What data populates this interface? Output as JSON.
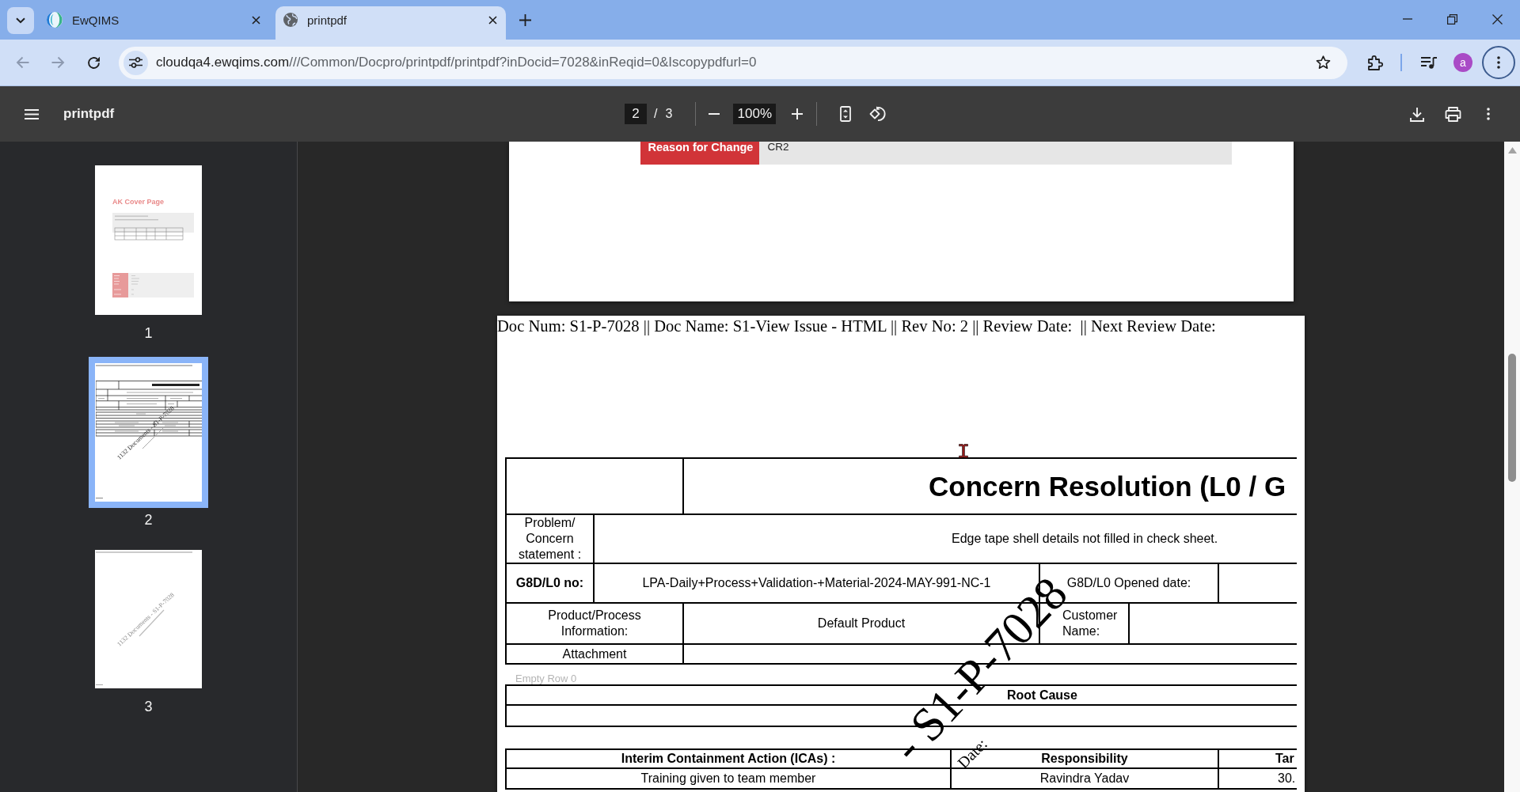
{
  "browser": {
    "tabs": [
      {
        "kind": "app",
        "title": "EwQIMS",
        "selected": false
      },
      {
        "kind": "web",
        "title": "printpdf",
        "selected": true
      }
    ],
    "navigation": [
      {
        "kind": "back",
        "disabled": true
      },
      {
        "kind": "forward",
        "disabled": true
      },
      {
        "kind": "reload",
        "disabled": false
      }
    ],
    "address": {
      "host": "cloudqa4.ewqims.com",
      "path": "///Common/Docpro/printpdf/printpdf?inDocid=7028&inReqid=0&Iscopypdfurl=0"
    },
    "profile_initial": "a"
  },
  "viewer": {
    "title": "printpdf",
    "page": "2",
    "separator": "/",
    "page_count": "3",
    "zoom": "100%"
  },
  "thumbnails": [
    {
      "kind": "cover",
      "heading": "AK Cover Page",
      "label": "1",
      "selected": false
    },
    {
      "kind": "form",
      "watermark": "1132 Documents - S1-P-7028",
      "label": "2",
      "selected": true
    },
    {
      "kind": "blank",
      "watermark": "1132 Documents - S1-P-7028",
      "label": "3",
      "selected": false
    }
  ],
  "previous_page": {
    "field_label": "Reason for Change",
    "field_value": "CR2"
  },
  "current_page": {
    "header": "Doc Num: S1-P-7028 || Doc Name: S1-View Issue - HTML || Rev No: 2 || Review Date:  || Next Review Date:",
    "title": "Concern Resolution (L0 / G",
    "rows": [
      {
        "kind": "statement",
        "label": "Problem/ Concern statement :",
        "value": "Edge tape shell details not filled in check sheet."
      },
      {
        "kind": "number",
        "label": "G8D/L0 no:",
        "value": "LPA-Daily+Process+Validation-+Material-2024-MAY-991-NC-1",
        "extra_label": "G8D/L0 Opened date:"
      },
      {
        "kind": "product",
        "label": "Product/Process Information:",
        "value": "Default Product",
        "extra_label": "Customer Name:"
      },
      {
        "kind": "attachment",
        "label": "Attachment"
      }
    ],
    "spacer_text": "Empty Row 0",
    "root_cause": {
      "heading": "Root Cause"
    },
    "containment": {
      "columns": [
        "Interim Containment Action (ICAs) :",
        "Responsibility",
        "Tar"
      ],
      "rows": [
        [
          "Training given to team member",
          "Ravindra Yadav",
          "30."
        ]
      ]
    },
    "watermark": {
      "text": "- S1-P-7028",
      "note": "Date:"
    }
  }
}
